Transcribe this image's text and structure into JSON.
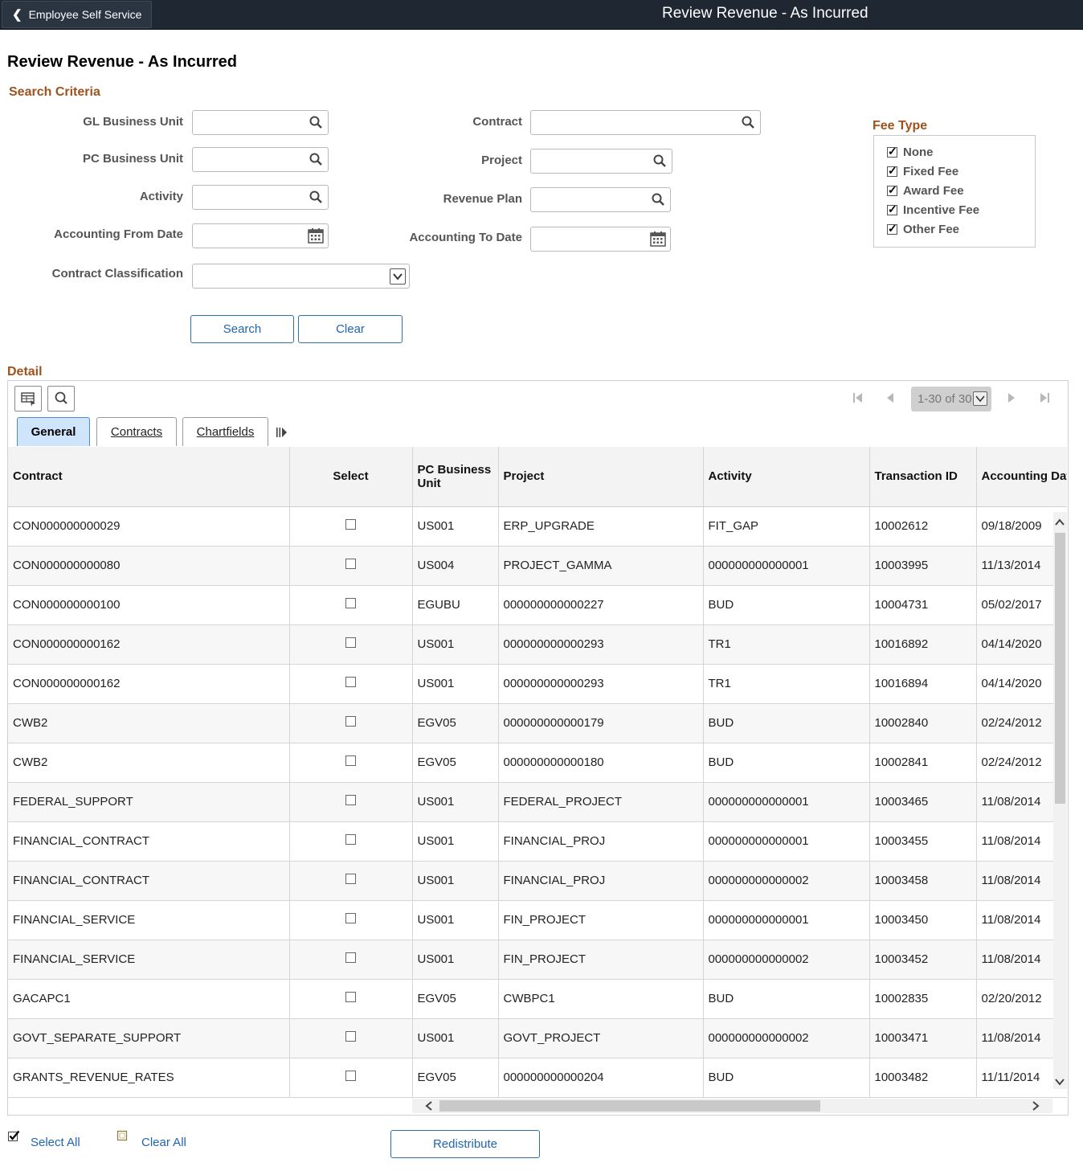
{
  "topbar": {
    "back_label": "Employee Self Service",
    "title": "Review Revenue - As Incurred"
  },
  "page_title": "Review Revenue - As Incurred",
  "search": {
    "section_title": "Search Criteria",
    "gl_business_unit": {
      "label": "GL Business Unit",
      "value": ""
    },
    "pc_business_unit": {
      "label": "PC Business Unit",
      "value": ""
    },
    "activity": {
      "label": "Activity",
      "value": ""
    },
    "accounting_from_date": {
      "label": "Accounting From Date",
      "value": ""
    },
    "contract_classification": {
      "label": "Contract Classification",
      "value": ""
    },
    "contract": {
      "label": "Contract",
      "value": ""
    },
    "project": {
      "label": "Project",
      "value": ""
    },
    "revenue_plan": {
      "label": "Revenue Plan",
      "value": ""
    },
    "accounting_to_date": {
      "label": "Accounting To Date",
      "value": ""
    },
    "search_label": "Search",
    "clear_label": "Clear"
  },
  "fee_type": {
    "title": "Fee Type",
    "options": [
      {
        "label": "None",
        "checked": true
      },
      {
        "label": "Fixed Fee",
        "checked": true
      },
      {
        "label": "Award Fee",
        "checked": true
      },
      {
        "label": "Incentive Fee",
        "checked": true
      },
      {
        "label": "Other Fee",
        "checked": true
      }
    ]
  },
  "detail": {
    "title": "Detail",
    "pager": "1-30 of 30",
    "tabs": [
      "General",
      "Contracts",
      "Chartfields"
    ],
    "columns": [
      "Contract",
      "Select",
      "PC Business Unit",
      "Project",
      "Activity",
      "Transaction ID",
      "Accounting Date"
    ],
    "rows": [
      [
        "CON000000000029",
        "US001",
        "ERP_UPGRADE",
        "FIT_GAP",
        "10002612",
        "09/18/2009"
      ],
      [
        "CON000000000080",
        "US004",
        "PROJECT_GAMMA",
        "000000000000001",
        "10003995",
        "11/13/2014"
      ],
      [
        "CON000000000100",
        "EGUBU",
        "000000000000227",
        "BUD",
        "10004731",
        "05/02/2017"
      ],
      [
        "CON000000000162",
        "US001",
        "000000000000293",
        "TR1",
        "10016892",
        "04/14/2020"
      ],
      [
        "CON000000000162",
        "US001",
        "000000000000293",
        "TR1",
        "10016894",
        "04/14/2020"
      ],
      [
        "CWB2",
        "EGV05",
        "000000000000179",
        "BUD",
        "10002840",
        "02/24/2012"
      ],
      [
        "CWB2",
        "EGV05",
        "000000000000180",
        "BUD",
        "10002841",
        "02/24/2012"
      ],
      [
        "FEDERAL_SUPPORT",
        "US001",
        "FEDERAL_PROJECT",
        "000000000000001",
        "10003465",
        "11/08/2014"
      ],
      [
        "FINANCIAL_CONTRACT",
        "US001",
        "FINANCIAL_PROJ",
        "000000000000001",
        "10003455",
        "11/08/2014"
      ],
      [
        "FINANCIAL_CONTRACT",
        "US001",
        "FINANCIAL_PROJ",
        "000000000000002",
        "10003458",
        "11/08/2014"
      ],
      [
        "FINANCIAL_SERVICE",
        "US001",
        "FIN_PROJECT",
        "000000000000001",
        "10003450",
        "11/08/2014"
      ],
      [
        "FINANCIAL_SERVICE",
        "US001",
        "FIN_PROJECT",
        "000000000000002",
        "10003452",
        "11/08/2014"
      ],
      [
        "GACAPC1",
        "EGV05",
        "CWBPC1",
        "BUD",
        "10002835",
        "02/20/2012"
      ],
      [
        "GOVT_SEPARATE_SUPPORT",
        "US001",
        "GOVT_PROJECT",
        "000000000000002",
        "10003471",
        "11/08/2014"
      ],
      [
        "GRANTS_REVENUE_RATES",
        "EGV05",
        "000000000000204",
        "BUD",
        "10003482",
        "11/11/2014"
      ]
    ]
  },
  "footer": {
    "select_all": "Select All",
    "clear_all": "Clear All",
    "redistribute": "Redistribute"
  }
}
